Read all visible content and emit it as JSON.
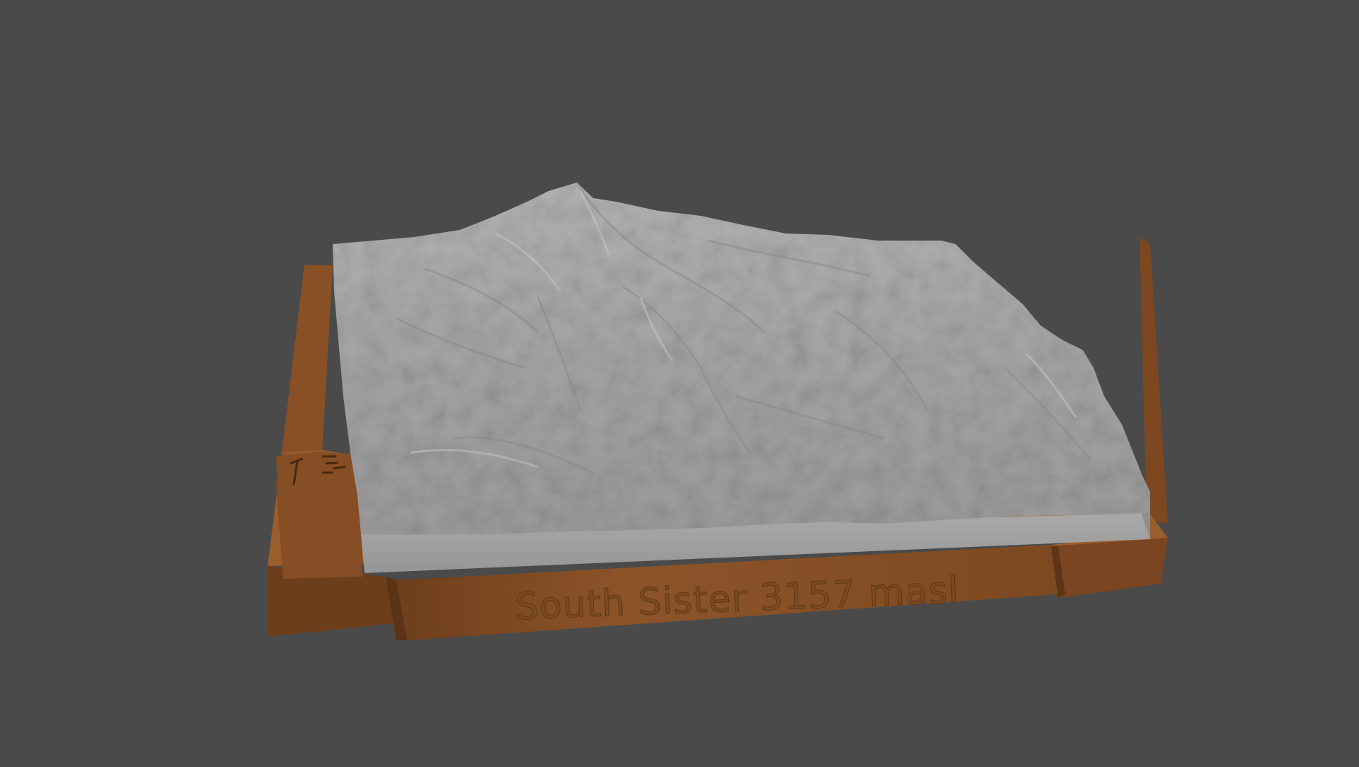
{
  "scene": {
    "background_color": "#4a4a4a",
    "terrain_color": "#a8a8a8",
    "base_color": "#8a5226",
    "engraved_label": "South Sister 3157 masl"
  }
}
